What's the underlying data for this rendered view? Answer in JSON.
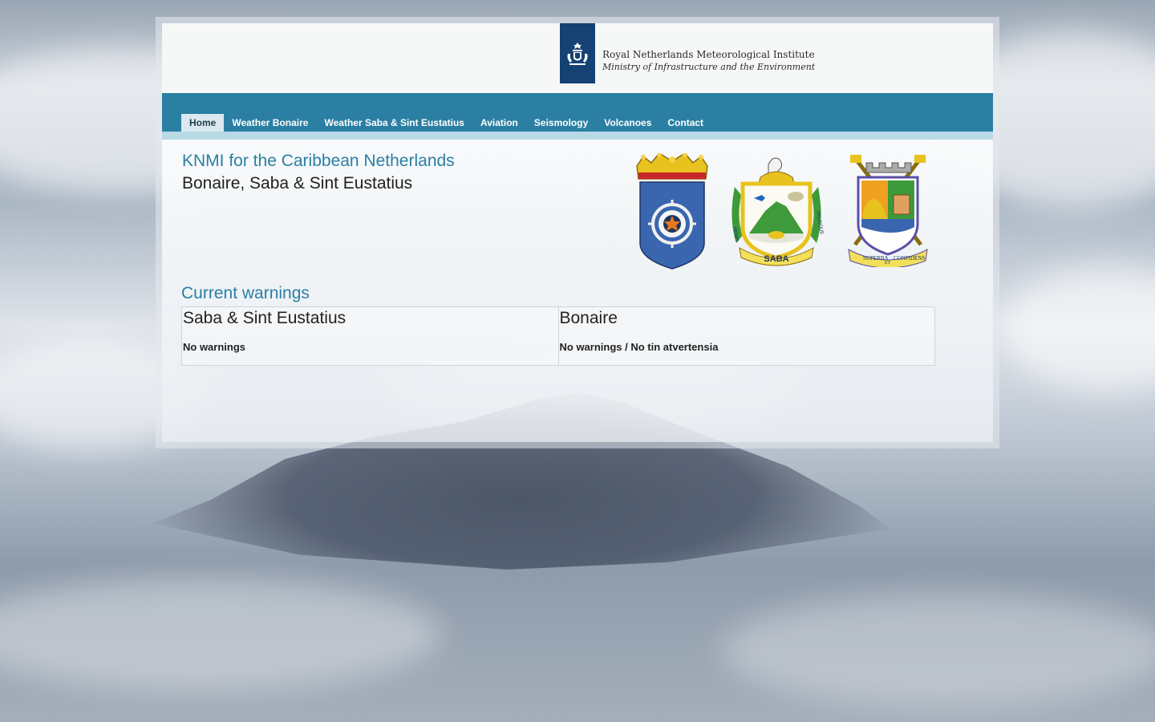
{
  "header": {
    "logo_line1": "Royal Netherlands Meteorological Institute",
    "logo_line2": "Ministry of Infrastructure and the Environment"
  },
  "nav": {
    "items": [
      {
        "label": "Home",
        "active": true
      },
      {
        "label": "Weather Bonaire"
      },
      {
        "label": "Weather Saba & Sint Eustatius"
      },
      {
        "label": "Aviation"
      },
      {
        "label": "Seismology"
      },
      {
        "label": "Volcanoes"
      },
      {
        "label": "Contact"
      }
    ]
  },
  "intro": {
    "title": "KNMI for the Caribbean Netherlands",
    "subtitle": "Bonaire, Saba & Sint Eustatius"
  },
  "coats": {
    "saba_label": "SABA",
    "saba_motto_left": "REMIS",
    "saba_motto_right": "VELISQUE",
    "statia_motto_left": "SUPERBA",
    "statia_motto_mid": "ET",
    "statia_motto_right": "CONFIDENS"
  },
  "warnings": {
    "heading": "Current warnings",
    "regions": [
      {
        "name": "Saba & Sint Eustatius",
        "status": "No warnings"
      },
      {
        "name": "Bonaire",
        "status": "No warnings / No tin atvertensia"
      }
    ]
  },
  "colors": {
    "accent": "#2a7fa3",
    "rijkslogo": "#154273"
  }
}
